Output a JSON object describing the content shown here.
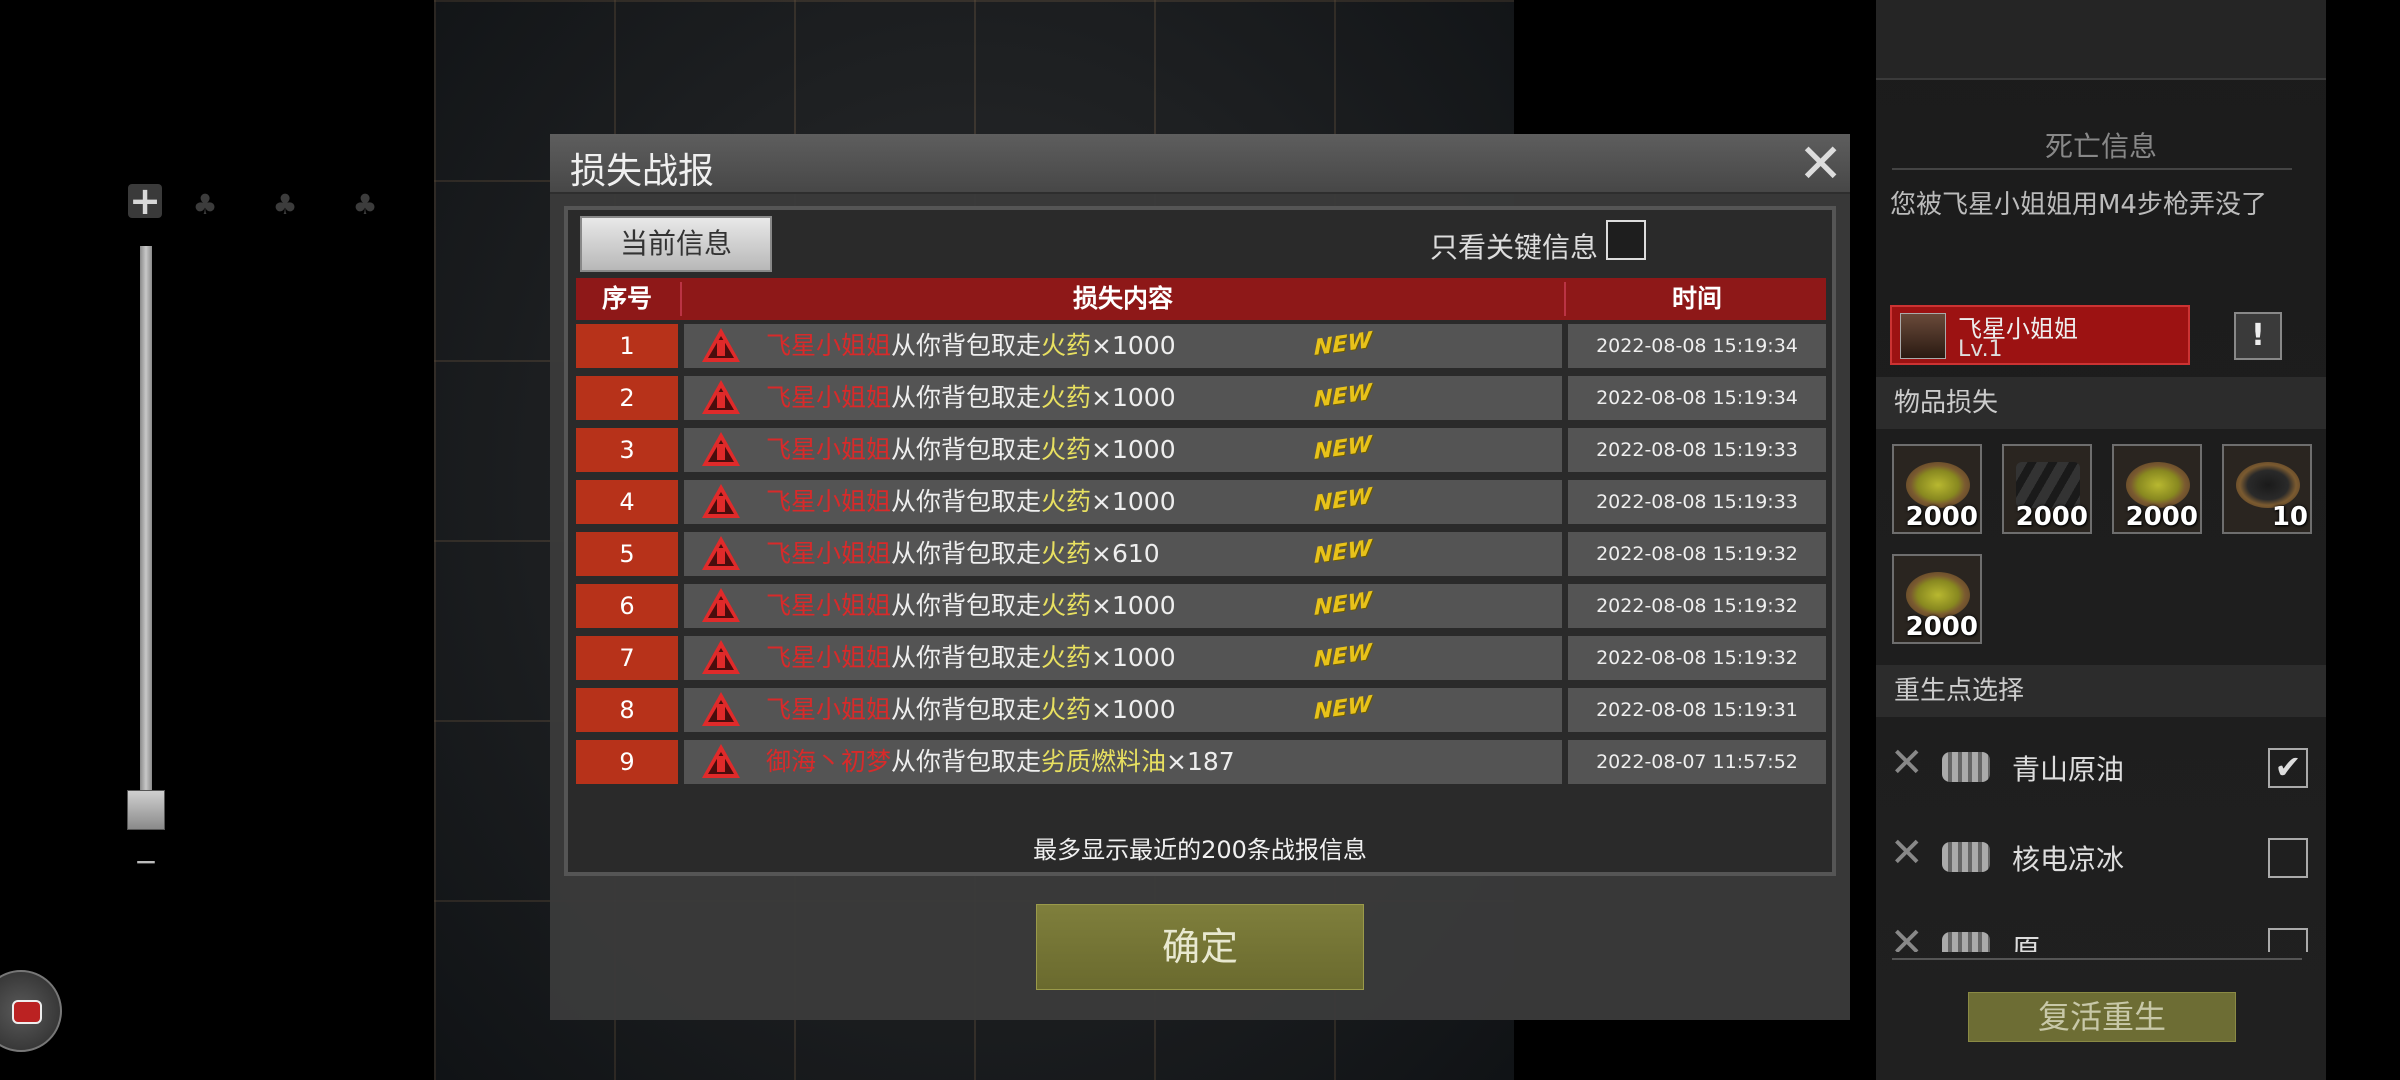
{
  "dialog": {
    "title": "损失战报",
    "close": "✕",
    "tab_current": "当前信息",
    "key_filter_label": "只看关键信息",
    "columns": [
      "序号",
      "损失内容",
      "时间"
    ],
    "rows": [
      {
        "num": "1",
        "who": "飞星小姐姐",
        "mid": "从你背包取走",
        "item": "火药",
        "qty": "×1000",
        "new": "NEW",
        "time": "2022-08-08 15:19:34"
      },
      {
        "num": "2",
        "who": "飞星小姐姐",
        "mid": "从你背包取走",
        "item": "火药",
        "qty": "×1000",
        "new": "NEW",
        "time": "2022-08-08 15:19:34"
      },
      {
        "num": "3",
        "who": "飞星小姐姐",
        "mid": "从你背包取走",
        "item": "火药",
        "qty": "×1000",
        "new": "NEW",
        "time": "2022-08-08 15:19:33"
      },
      {
        "num": "4",
        "who": "飞星小姐姐",
        "mid": "从你背包取走",
        "item": "火药",
        "qty": "×1000",
        "new": "NEW",
        "time": "2022-08-08 15:19:33"
      },
      {
        "num": "5",
        "who": "飞星小姐姐",
        "mid": "从你背包取走",
        "item": "火药",
        "qty": "×610",
        "new": "NEW",
        "time": "2022-08-08 15:19:32"
      },
      {
        "num": "6",
        "who": "飞星小姐姐",
        "mid": "从你背包取走",
        "item": "火药",
        "qty": "×1000",
        "new": "NEW",
        "time": "2022-08-08 15:19:32"
      },
      {
        "num": "7",
        "who": "飞星小姐姐",
        "mid": "从你背包取走",
        "item": "火药",
        "qty": "×1000",
        "new": "NEW",
        "time": "2022-08-08 15:19:32"
      },
      {
        "num": "8",
        "who": "飞星小姐姐",
        "mid": "从你背包取走",
        "item": "火药",
        "qty": "×1000",
        "new": "NEW",
        "time": "2022-08-08 15:19:31"
      },
      {
        "num": "9",
        "who": "御海丶初梦",
        "mid": "从你背包取走",
        "item": "劣质燃料油",
        "qty": "×187",
        "new": "",
        "time": "2022-08-07 11:57:52"
      }
    ],
    "footer_note": "最多显示最近的200条战报信息",
    "confirm": "确定"
  },
  "death_panel": {
    "title": "死亡信息",
    "message": "您被飞星小姐姐用M4步枪弄没了",
    "killer_name": "飞星小姐姐",
    "killer_level": "Lv.1",
    "report_icon": "!",
    "items_title": "物品损失",
    "items": [
      {
        "icon": "gunpowder-icon",
        "qty": "2000"
      },
      {
        "icon": "metal-bars-icon",
        "qty": "2000"
      },
      {
        "icon": "gunpowder-icon",
        "qty": "2000"
      },
      {
        "icon": "coal-icon",
        "qty": "10"
      },
      {
        "icon": "gunpowder-icon",
        "qty": "2000"
      }
    ],
    "respawn_title": "重生点选择",
    "respawn_points": [
      {
        "label": "青山原油",
        "checked": "✔"
      },
      {
        "label": "核电凉冰",
        "checked": ""
      },
      {
        "label": "原",
        "checked": ""
      }
    ],
    "respawn_button": "复活重生"
  },
  "zoom": {
    "plus": "+",
    "minus": "−"
  },
  "colors": {
    "accent_red": "#8e1818",
    "row_num_red": "#b7321a",
    "item_yellow": "#e8e060",
    "confirm_olive": "#7f7f3c"
  }
}
